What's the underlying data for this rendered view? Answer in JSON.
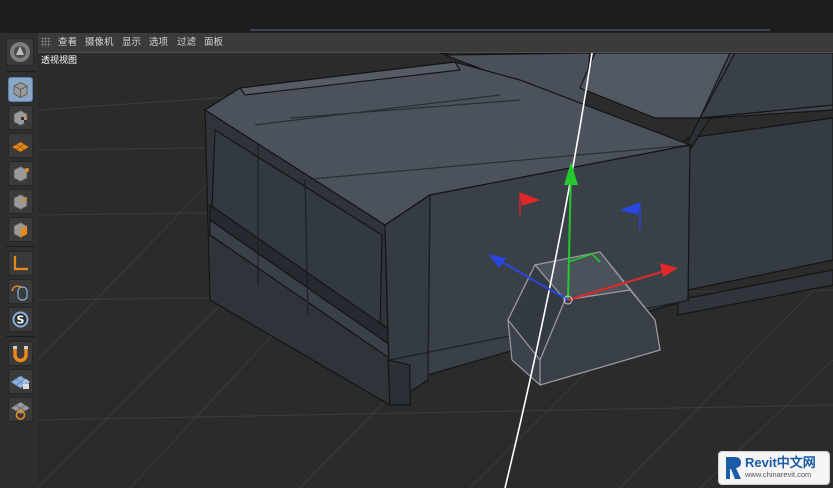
{
  "menu": {
    "items": [
      "查看",
      "摄像机",
      "显示",
      "选项",
      "过滤",
      "面板"
    ]
  },
  "viewport": {
    "label": "透视视图"
  },
  "toolbar": {
    "tools": [
      {
        "icon": "app-logo-icon",
        "state": "normal"
      },
      {
        "icon": "model-mode-icon",
        "state": "active"
      },
      {
        "icon": "texture-mode-icon",
        "state": "normal"
      },
      {
        "icon": "texture-axis-mode-icon",
        "state": "normal"
      },
      {
        "icon": "point-mode-icon",
        "state": "normal"
      },
      {
        "icon": "edge-mode-icon",
        "state": "normal"
      },
      {
        "icon": "polygon-mode-icon",
        "state": "normal"
      },
      {
        "icon": "axis-mode-icon",
        "state": "normal"
      },
      {
        "icon": "tweak-mode-icon",
        "state": "normal"
      },
      {
        "icon": "solo-mode-icon",
        "state": "normal"
      },
      {
        "icon": "snap-magnet-icon",
        "state": "normal"
      },
      {
        "icon": "workplane-lock-icon",
        "state": "normal"
      },
      {
        "icon": "workplane-align-icon",
        "state": "normal"
      }
    ]
  },
  "watermark": {
    "brand": "Revit中文网",
    "url": "www.chinarevit.com"
  },
  "colors": {
    "background": "#2b2b2b",
    "toolbar_active": "#8aa7c7",
    "axis_x": "#e02828",
    "axis_y": "#22c82c",
    "axis_z": "#2a45e0",
    "orange_icon": "#e88a1a"
  }
}
